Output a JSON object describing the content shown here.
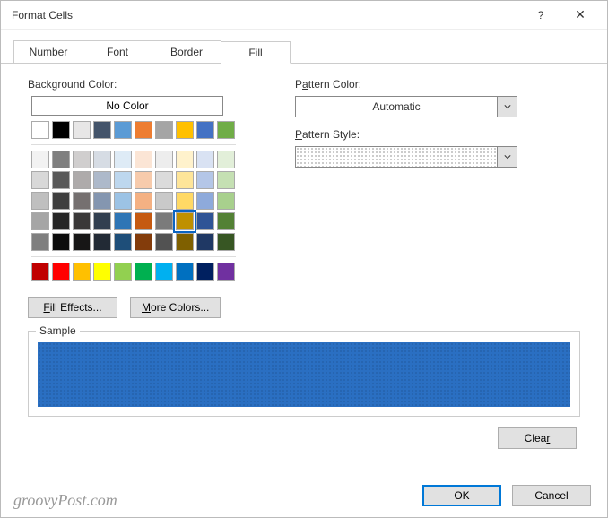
{
  "window": {
    "title": "Format Cells",
    "help_icon": "?",
    "close_icon": "✕"
  },
  "tabs": [
    {
      "label": "Number",
      "active": false
    },
    {
      "label": "Font",
      "active": false
    },
    {
      "label": "Border",
      "active": false
    },
    {
      "label": "Fill",
      "active": true
    }
  ],
  "labels": {
    "background_color": "Background Color:",
    "no_color": "No Color",
    "pattern_color": "Pattern Color:",
    "pattern_style": "Pattern Style:",
    "sample": "Sample"
  },
  "pattern_color": {
    "value": "Automatic"
  },
  "buttons": {
    "fill_effects": "Fill Effects...",
    "more_colors": "More Colors...",
    "clear": "Clear",
    "ok": "OK",
    "cancel": "Cancel"
  },
  "selected_color": "#4a90d6",
  "palette": {
    "theme_row": [
      "#ffffff",
      "#000000",
      "#e7e6e6",
      "#44546a",
      "#5b9bd5",
      "#ed7d31",
      "#a5a5a5",
      "#ffc000",
      "#4472c4",
      "#70ad47"
    ],
    "theme_tints": [
      [
        "#f2f2f2",
        "#7f7f7f",
        "#d0cece",
        "#d6dce4",
        "#deebf6",
        "#fbe5d5",
        "#ededed",
        "#fff2cc",
        "#d9e2f3",
        "#e2efd9"
      ],
      [
        "#d8d8d8",
        "#595959",
        "#aeabab",
        "#adb9ca",
        "#bdd7ee",
        "#f7cbac",
        "#dbdbdb",
        "#fee599",
        "#b4c6e7",
        "#c5e0b3"
      ],
      [
        "#bfbfbf",
        "#3f3f3f",
        "#757070",
        "#8496b0",
        "#9cc3e5",
        "#f4b183",
        "#c9c9c9",
        "#ffd965",
        "#8eaadb",
        "#a8d08d"
      ],
      [
        "#a5a5a5",
        "#262626",
        "#3a3838",
        "#323f4f",
        "#2e75b5",
        "#c55a11",
        "#7b7b7b",
        "#bf9000",
        "#2f5496",
        "#538135"
      ],
      [
        "#7f7f7f",
        "#0c0c0c",
        "#171616",
        "#222a35",
        "#1e4e79",
        "#833c0b",
        "#525252",
        "#7f6000",
        "#1f3864",
        "#375623"
      ]
    ],
    "standard": [
      "#c00000",
      "#ff0000",
      "#ffc000",
      "#ffff00",
      "#92d050",
      "#00b050",
      "#00b0f0",
      "#0070c0",
      "#002060",
      "#7030a0"
    ]
  },
  "watermark": "groovyPost.com"
}
